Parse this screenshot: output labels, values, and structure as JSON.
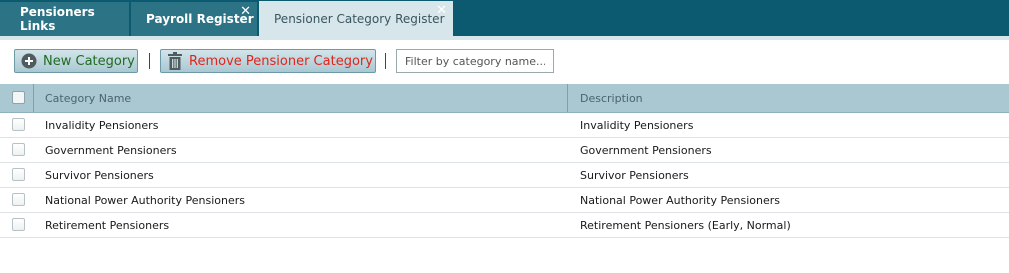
{
  "tabs": [
    {
      "label": "Pensioners Links",
      "closable": false,
      "active": false
    },
    {
      "label": "Payroll Register",
      "closable": true,
      "active": false
    },
    {
      "label": "Pensioner Category Register",
      "closable": true,
      "active": true
    }
  ],
  "toolbar": {
    "new_label": "New Category",
    "remove_label": "Remove Pensioner Category",
    "filter_placeholder": "Filter by category name..."
  },
  "grid": {
    "columns": [
      "Category Name",
      "Description"
    ],
    "rows": [
      {
        "name": "Invalidity Pensioners",
        "description": "Invalidity Pensioners"
      },
      {
        "name": "Government Pensioners",
        "description": "Government Pensioners"
      },
      {
        "name": "Survivor Pensioners",
        "description": "Survivor Pensioners"
      },
      {
        "name": "National Power Authority Pensioners",
        "description": "National Power Authority Pensioners"
      },
      {
        "name": "Retirement Pensioners",
        "description": "Retirement Pensioners (Early, Normal)"
      }
    ]
  },
  "icons": {
    "new": "plus-circle-icon",
    "remove": "trash-icon",
    "close": "close-icon"
  },
  "colors": {
    "tabbar": "#0b5a70",
    "active_tab": "#d6e6ea",
    "header": "#a9c8d2",
    "new_text": "#1f6b21",
    "remove_text": "#e0241b"
  }
}
